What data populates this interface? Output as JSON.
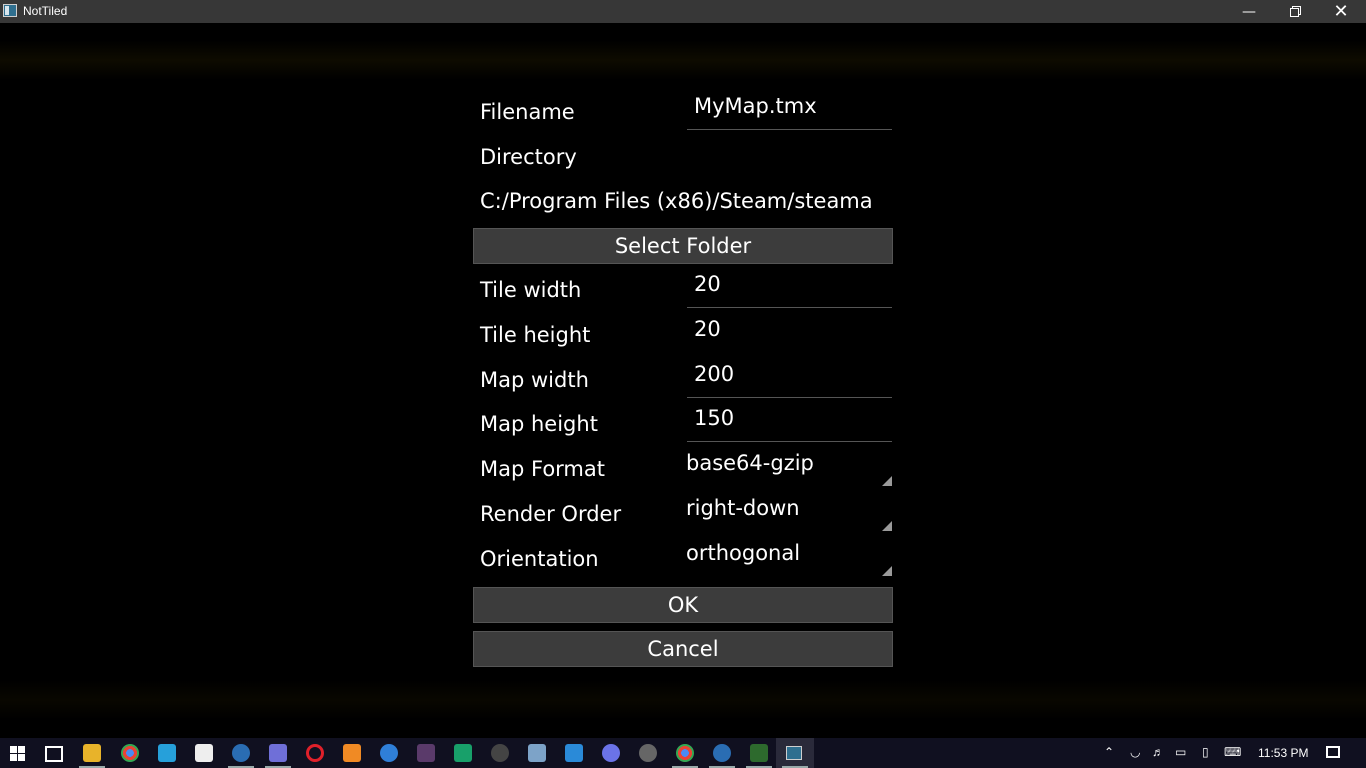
{
  "window": {
    "title": "NotTiled"
  },
  "dialog": {
    "filename_label": "Filename",
    "filename_value": "MyMap.tmx",
    "directory_label": "Directory",
    "directory_path": "C:/Program Files (x86)/Steam/steama",
    "select_folder_label": "Select Folder",
    "tile_width_label": "Tile width",
    "tile_width_value": "20",
    "tile_height_label": "Tile height",
    "tile_height_value": "20",
    "map_width_label": "Map width",
    "map_width_value": "200",
    "map_height_label": "Map height",
    "map_height_value": "150",
    "map_format_label": "Map Format",
    "map_format_value": "base64-gzip",
    "render_order_label": "Render Order",
    "render_order_value": "right-down",
    "orientation_label": "Orientation",
    "orientation_value": "orthogonal",
    "ok_label": "OK",
    "cancel_label": "Cancel"
  },
  "taskbar": {
    "clock": "11:53 PM",
    "pinned_icons": [
      "file-explorer-icon",
      "chrome-icon",
      "app-a-icon",
      "app-icon",
      "steam-icon",
      "tasks-icon",
      "opera-icon",
      "sublime-icon",
      "bluetooth-icon",
      "app-icon",
      "monitor-icon",
      "obs-icon",
      "remote-icon",
      "vscode-icon",
      "discord-icon",
      "radiation-icon",
      "chrome-icon",
      "steam-icon",
      "game-icon",
      "nottiled-icon"
    ]
  }
}
